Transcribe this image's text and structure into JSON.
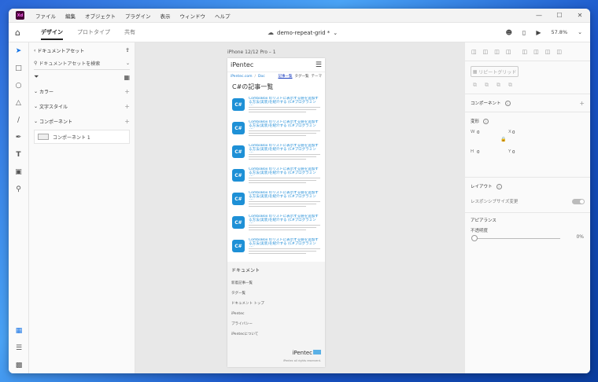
{
  "titlebar": {
    "app_icon": "Xd",
    "menu": [
      "ファイル",
      "編集",
      "オブジェクト",
      "プラグイン",
      "表示",
      "ウィンドウ",
      "ヘルプ"
    ]
  },
  "toolbar": {
    "tabs": [
      "デザイン",
      "プロトタイプ",
      "共有"
    ],
    "doc_title": "demo-repeat-grid *",
    "zoom": "57.8%"
  },
  "assets": {
    "header": "ドキュメントアセット",
    "search_placeholder": "ドキュメントアセットを検索",
    "sections": {
      "colors": "カラー",
      "text_styles": "文字スタイル",
      "components": "コンポーネント"
    },
    "component_item": "コンポーネント 1"
  },
  "canvas": {
    "artboard_label": "iPhone 12/12 Pro – 1"
  },
  "page": {
    "logo": "iPentec",
    "crumb_1": "iPentec.com",
    "crumb_sep": "/",
    "crumb_2": "Doc",
    "nav": [
      "記事一覧",
      "タグ一覧",
      "テーマ"
    ],
    "title": "C#の記事一覧",
    "item_icon": "C#",
    "item_title": "ComboBox のリストに表示する値を追加する方法(実装)を紹介する (C#プログラミング)",
    "footer_heading": "ドキュメント",
    "footer_links": [
      "新着記事一覧",
      "タグ一覧",
      "ドキュメント トップ",
      "iPentec",
      "プライバシー",
      "iPentecについて"
    ],
    "footer_logo": "iPentec",
    "footer_copy": "iPentec all rights reserverd."
  },
  "props": {
    "repeat_grid": "リピートグリッド",
    "component": "コンポーネント",
    "transform": "変形",
    "w_label": "W",
    "w_value": "0",
    "h_label": "H",
    "h_value": "0",
    "x_label": "X",
    "x_value": "0",
    "y_label": "Y",
    "y_value": "0",
    "layout": "レイアウト",
    "responsive": "レスポンシブサイズ変更",
    "appearance": "アピアランス",
    "opacity": "不透明度",
    "opacity_value": "0%"
  }
}
